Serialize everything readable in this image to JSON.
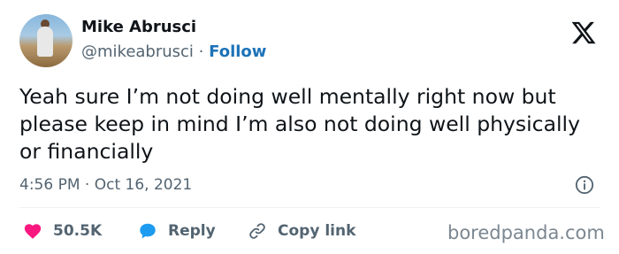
{
  "author": {
    "name": "Mike Abrusci",
    "handle": "@mikeabrusci",
    "separator": "·",
    "follow_label": "Follow"
  },
  "tweet": {
    "text": "Yeah sure I’m not doing well mentally right now but please keep in mind I’m also not doing well physically or financially",
    "time": "4:56 PM",
    "separator": "·",
    "date": "Oct 16, 2021"
  },
  "actions": {
    "likes_count": "50.5K",
    "reply_label": "Reply",
    "copy_link_label": "Copy link"
  },
  "icons": {
    "logo": "x-logo-icon",
    "info": "info-icon",
    "like": "heart-icon",
    "reply": "speech-bubble-icon",
    "copy": "link-icon"
  },
  "colors": {
    "text": "#0f1419",
    "muted": "#536471",
    "link": "#1d73b8",
    "heart": "#f91880",
    "reply": "#1d9bf0"
  },
  "watermark": "boredpanda.com"
}
